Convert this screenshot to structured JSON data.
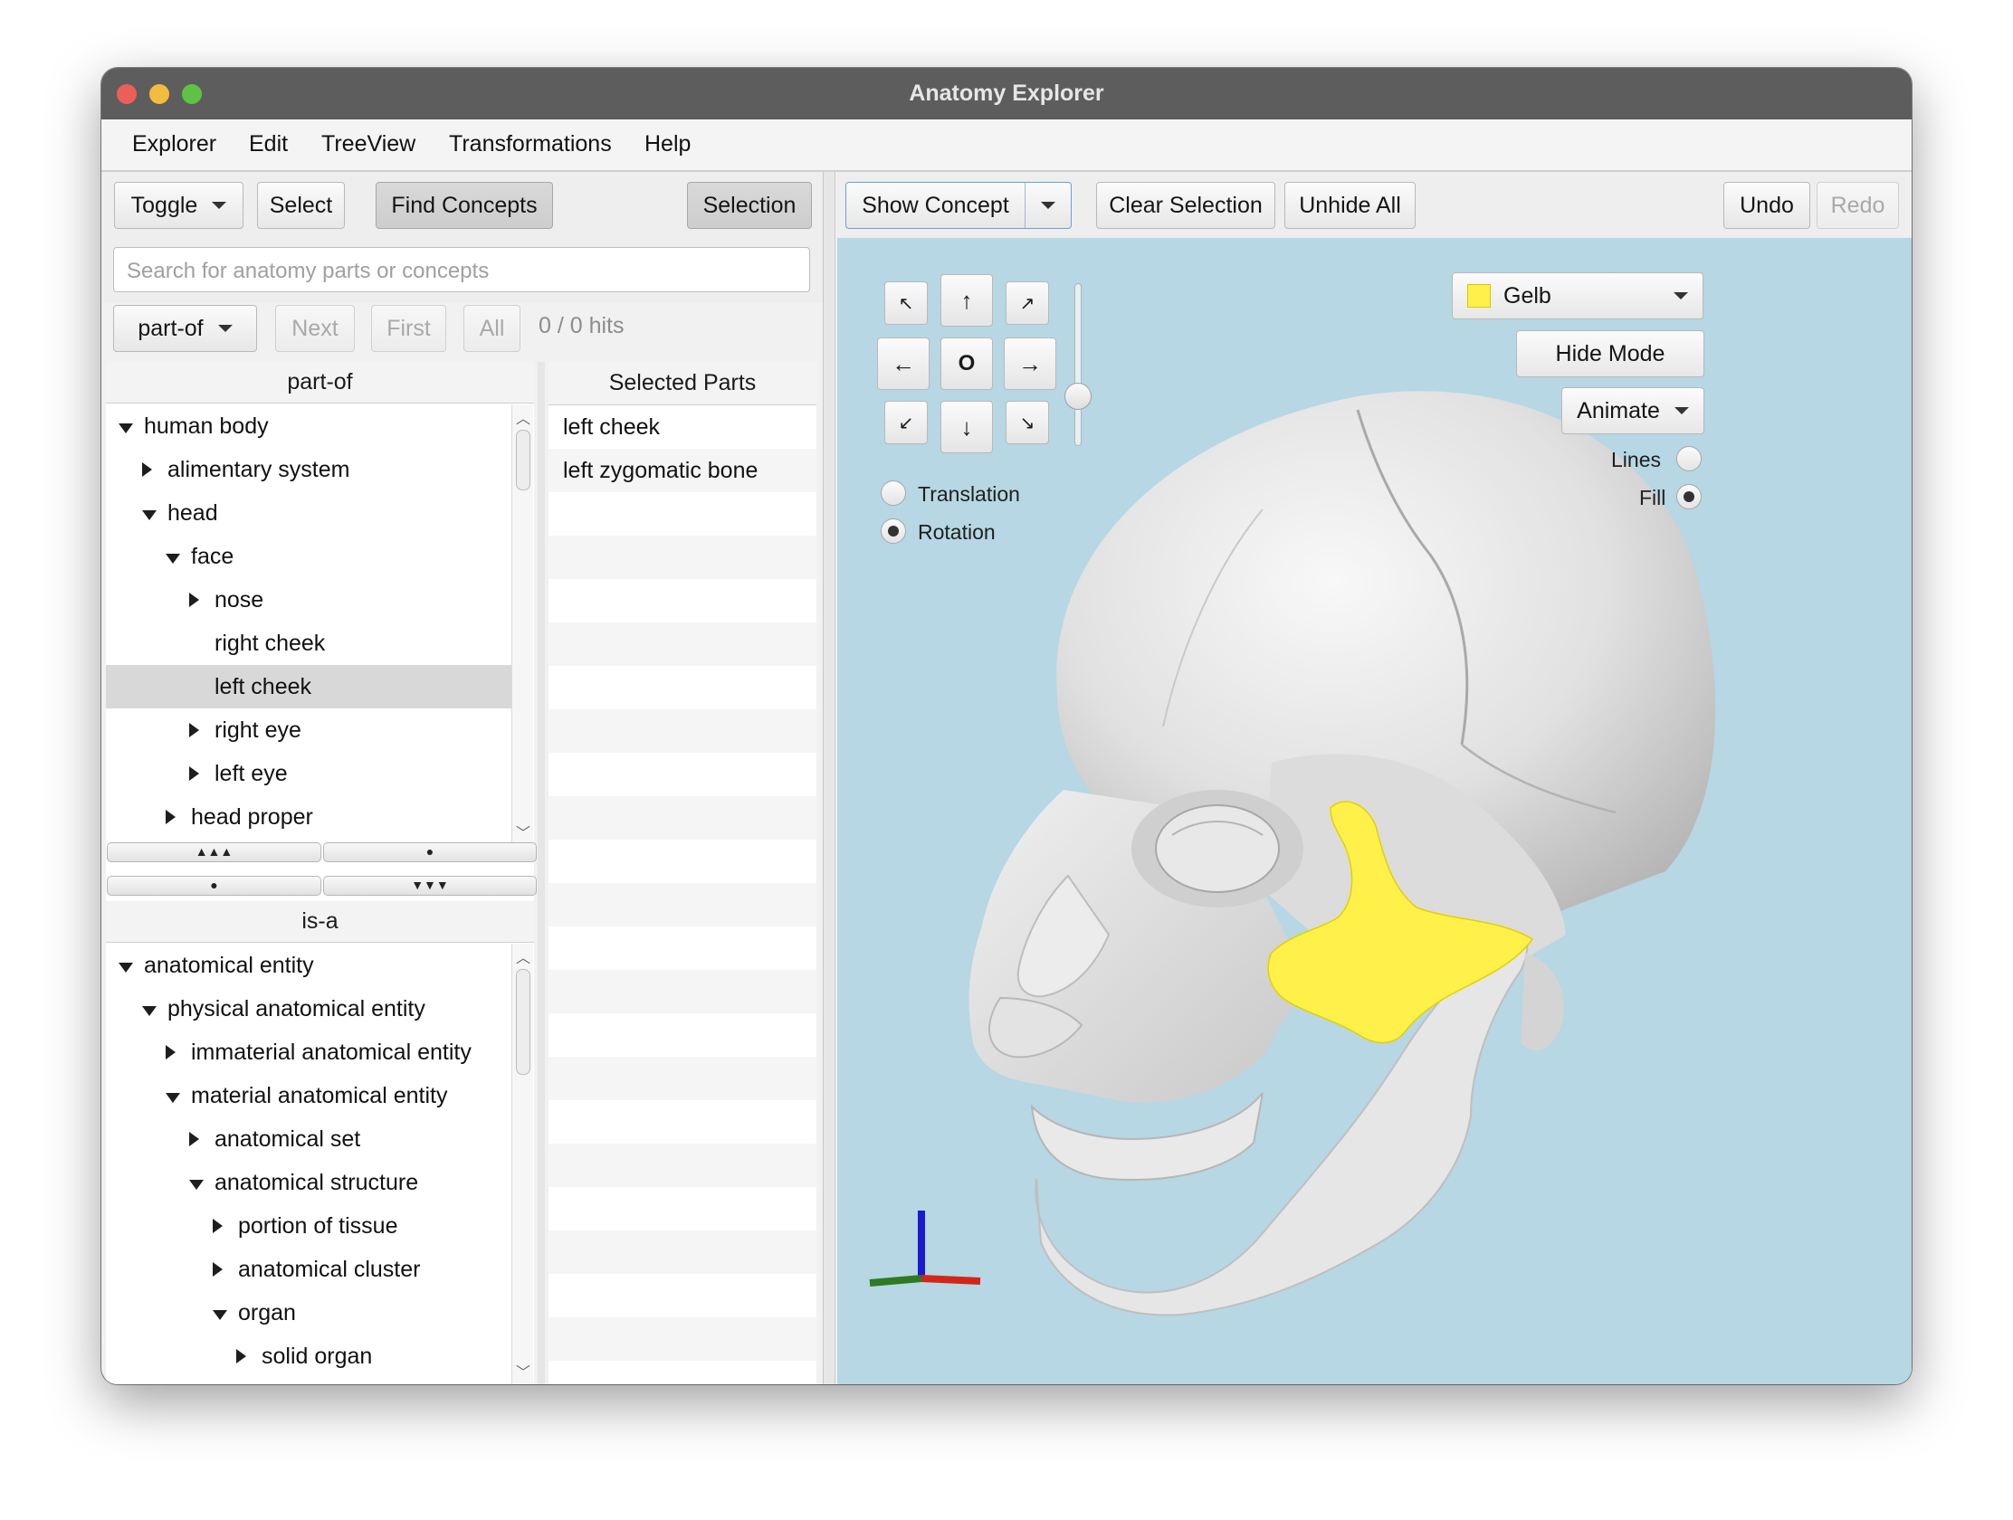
{
  "window": {
    "title": "Anatomy Explorer"
  },
  "menubar": {
    "items": [
      "Explorer",
      "Edit",
      "TreeView",
      "Transformations",
      "Help"
    ]
  },
  "left_toolbar": {
    "toggle": "Toggle",
    "select": "Select",
    "find_concepts": "Find Concepts",
    "selection": "Selection"
  },
  "search": {
    "placeholder": "Search for anatomy parts or concepts",
    "relation": "part-of",
    "next": "Next",
    "first": "First",
    "all": "All",
    "hits": "0 / 0 hits"
  },
  "part_of_tree": {
    "header": "part-of",
    "rows": [
      {
        "label": "human body",
        "level": 0,
        "state": "expanded"
      },
      {
        "label": "alimentary system",
        "level": 1,
        "state": "collapsed"
      },
      {
        "label": "head",
        "level": 1,
        "state": "expanded"
      },
      {
        "label": "face",
        "level": 2,
        "state": "expanded"
      },
      {
        "label": "nose",
        "level": 3,
        "state": "collapsed"
      },
      {
        "label": "right cheek",
        "level": 3,
        "state": "leaf"
      },
      {
        "label": "left cheek",
        "level": 3,
        "state": "leaf",
        "selected": true
      },
      {
        "label": "right eye",
        "level": 3,
        "state": "collapsed"
      },
      {
        "label": "left eye",
        "level": 3,
        "state": "collapsed"
      },
      {
        "label": "head proper",
        "level": 2,
        "state": "collapsed"
      }
    ]
  },
  "is_a_tree": {
    "header": "is-a",
    "rows": [
      {
        "label": "anatomical entity",
        "level": 0,
        "state": "expanded"
      },
      {
        "label": "physical anatomical entity",
        "level": 1,
        "state": "expanded"
      },
      {
        "label": "immaterial anatomical entity",
        "level": 2,
        "state": "collapsed"
      },
      {
        "label": "material anatomical entity",
        "level": 2,
        "state": "expanded"
      },
      {
        "label": "anatomical set",
        "level": 3,
        "state": "collapsed"
      },
      {
        "label": "anatomical structure",
        "level": 3,
        "state": "expanded"
      },
      {
        "label": "portion of tissue",
        "level": 4,
        "state": "collapsed"
      },
      {
        "label": "anatomical cluster",
        "level": 4,
        "state": "collapsed"
      },
      {
        "label": "organ",
        "level": 4,
        "state": "expanded"
      },
      {
        "label": "solid organ",
        "level": 5,
        "state": "collapsed"
      }
    ]
  },
  "selected_parts": {
    "header": "Selected Parts",
    "items": [
      "left cheek",
      "left zygomatic bone"
    ]
  },
  "right_toolbar": {
    "show_concept": "Show Concept",
    "clear_selection": "Clear Selection",
    "unhide_all": "Unhide All",
    "undo": "Undo",
    "redo": "Redo"
  },
  "viewer": {
    "color_select": "Gelb",
    "highlight_color": "#fff04a",
    "background_color": "#b6d7e3",
    "hide_mode": "Hide Mode",
    "animate": "Animate",
    "lines_label": "Lines",
    "fill_label": "Fill",
    "render_mode": "Fill",
    "translation_label": "Translation",
    "rotation_label": "Rotation",
    "transform_mode": "Rotation",
    "center_label": "O",
    "zoom_level": 0.75
  }
}
